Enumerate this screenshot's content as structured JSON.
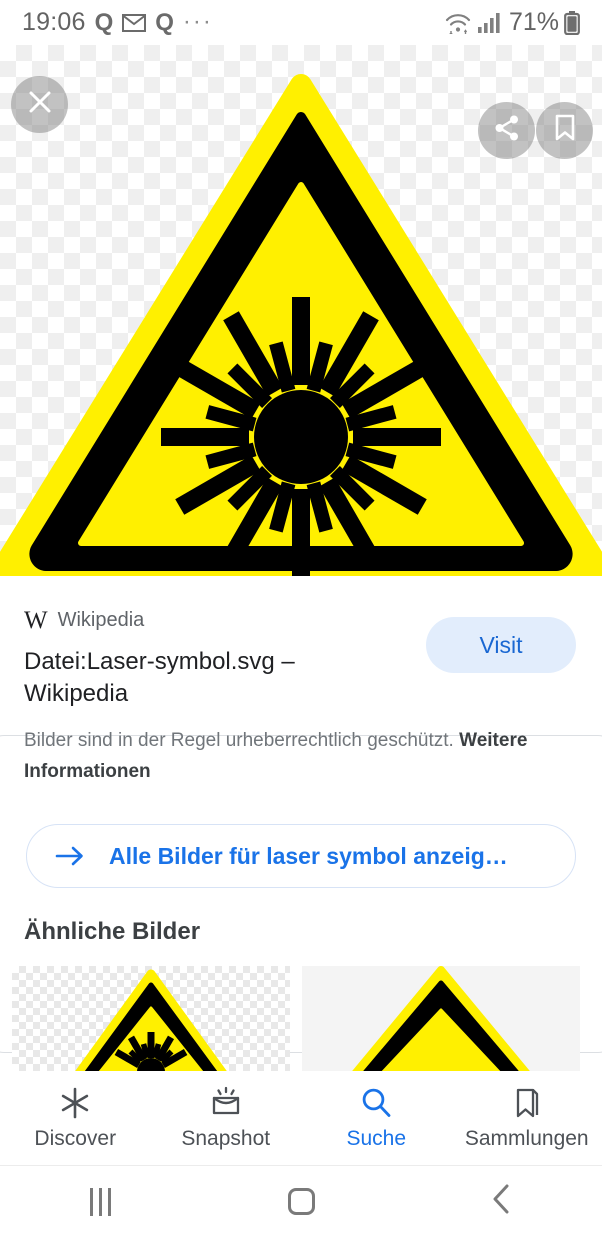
{
  "status_bar": {
    "time": "19:06",
    "left_icons": [
      "quora-icon",
      "mail-icon",
      "quora-icon",
      "more-icon"
    ],
    "battery_percent": "71%",
    "right_icons": [
      "wifi-icon",
      "signal-icon",
      "battery-icon"
    ]
  },
  "hero": {
    "image_alt": "Laser warning triangle symbol",
    "background": "transparency-checkerboard",
    "colors": {
      "yellow": "#FFF000",
      "black": "#000000"
    },
    "close_button": "close-icon",
    "share_button": "share-icon",
    "bookmark_button": "bookmark-icon"
  },
  "result_card": {
    "source_logo": "wikipedia-w-icon",
    "source_name": "Wikipedia",
    "title": "Datei:Laser-symbol.svg – Wikipedia",
    "visit_label": "Visit",
    "notice_text": "Bilder sind in der Regel urheberrechtlich geschützt.",
    "notice_link": "Weitere Informationen",
    "all_images_label": "Alle Bilder für laser symbol anzeig…",
    "all_images_icon": "arrow-right-icon",
    "similar_heading": "Ähnliche Bilder",
    "thumbnails": [
      {
        "name": "similar-image-1",
        "alt": "Laser warning triangle on checkerboard"
      },
      {
        "name": "similar-image-2",
        "alt": "Laser warning triangle on light page"
      }
    ],
    "accent_color": "#1a73e8",
    "visit_bg": "#e2edfc"
  },
  "bottom_nav": {
    "items": [
      {
        "label": "Discover",
        "icon": "asterisk-icon",
        "active": false
      },
      {
        "label": "Snapshot",
        "icon": "snapshot-icon",
        "active": false
      },
      {
        "label": "Suche",
        "icon": "search-icon",
        "active": true
      },
      {
        "label": "Sammlungen",
        "icon": "bookmark-icon",
        "active": false
      }
    ]
  },
  "system_nav": {
    "recents": "recents-icon",
    "home": "home-icon",
    "back": "back-icon"
  }
}
